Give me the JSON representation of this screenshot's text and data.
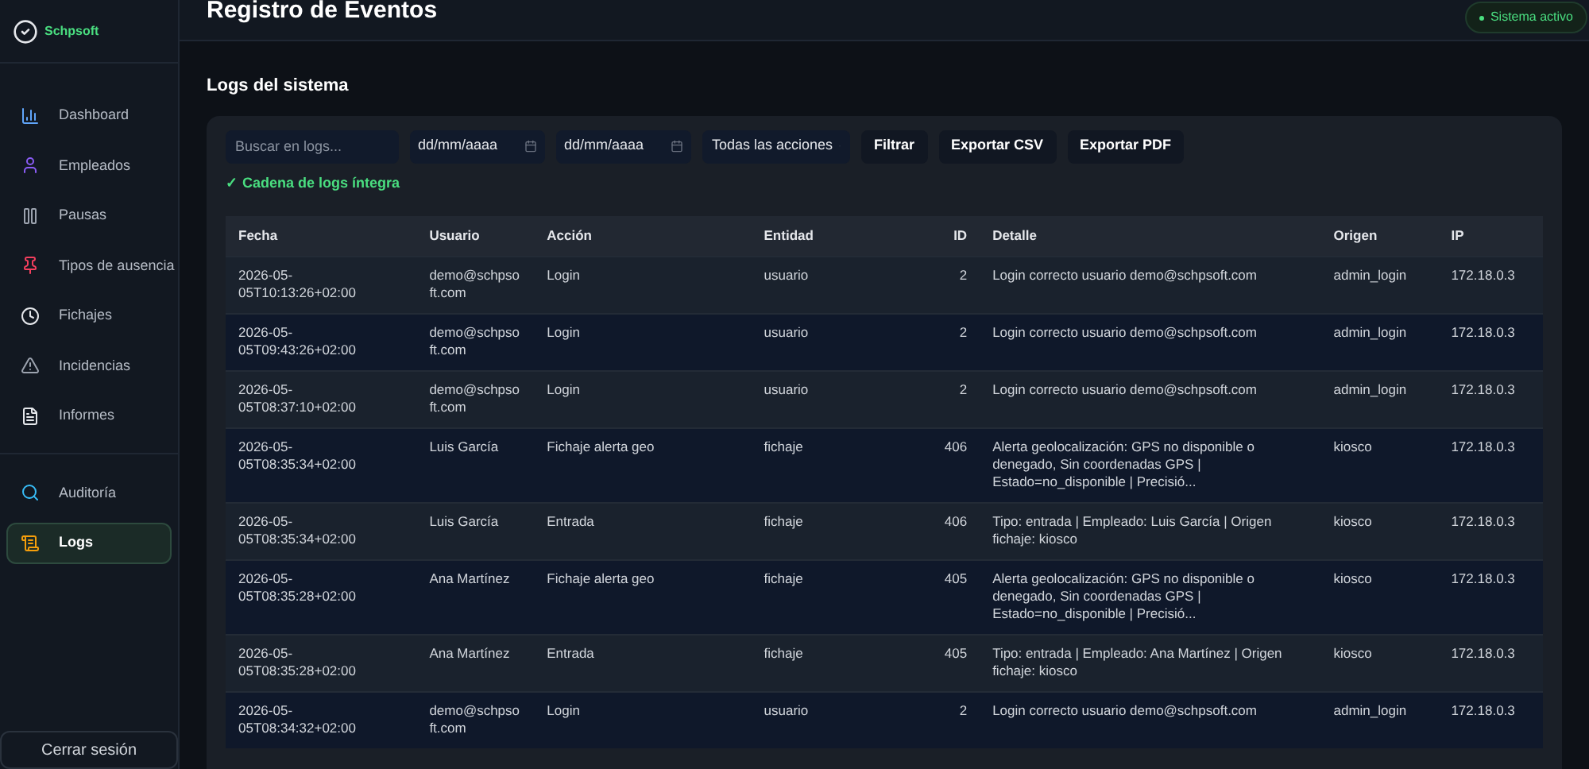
{
  "brand": {
    "name": "Schpsoft"
  },
  "sidebar": {
    "groups": [
      [
        {
          "label": "Dashboard",
          "selected": false
        },
        {
          "label": "Empleados",
          "selected": false
        },
        {
          "label": "Pausas",
          "selected": false
        },
        {
          "label": "Tipos de ausencia",
          "selected": false
        },
        {
          "label": "Fichajes",
          "selected": false
        },
        {
          "label": "Incidencias",
          "selected": false
        },
        {
          "label": "Informes",
          "selected": false
        }
      ],
      [
        {
          "label": "Auditoría",
          "selected": false
        },
        {
          "label": "Logs",
          "selected": true
        }
      ]
    ],
    "logout": "Cerrar sesión"
  },
  "header": {
    "title": "Registro de Eventos",
    "status": "Sistema activo"
  },
  "section_title": "Logs del sistema",
  "filters": {
    "search_placeholder": "Buscar en logs...",
    "date_from": "dd/mm/aaaa",
    "date_to": "dd/mm/aaaa",
    "action_select": "Todas las acciones",
    "buttons": [
      "Filtrar",
      "Exportar CSV",
      "Exportar PDF"
    ],
    "integrity": "✓ Cadena de logs íntegra",
    "integrity_ok": true
  },
  "table": {
    "columns": [
      "Fecha",
      "Usuario",
      "Acción",
      "Entidad",
      "ID",
      "Detalle",
      "Origen",
      "IP"
    ],
    "rows": [
      [
        "2026-05-05T10:13:26+02:00",
        "demo@schpsoft.com",
        "Login",
        "usuario",
        "2",
        "Login correcto usuario demo@schpsoft.com",
        "admin_login",
        "172.18.0.3"
      ],
      [
        "2026-05-05T09:43:26+02:00",
        "demo@schpsoft.com",
        "Login",
        "usuario",
        "2",
        "Login correcto usuario demo@schpsoft.com",
        "admin_login",
        "172.18.0.3"
      ],
      [
        "2026-05-05T08:37:10+02:00",
        "demo@schpsoft.com",
        "Login",
        "usuario",
        "2",
        "Login correcto usuario demo@schpsoft.com",
        "admin_login",
        "172.18.0.3"
      ],
      [
        "2026-05-05T08:35:34+02:00",
        "Luis García",
        "Fichaje alerta geo",
        "fichaje",
        "406",
        "Alerta geolocalización: GPS no disponible o denegado, Sin coordenadas GPS | Estado=no_disponible | Precisió...",
        "kiosco",
        "172.18.0.3"
      ],
      [
        "2026-05-05T08:35:34+02:00",
        "Luis García",
        "Entrada",
        "fichaje",
        "406",
        "Tipo: entrada | Empleado: Luis García | Origen fichaje: kiosco",
        "kiosco",
        "172.18.0.3"
      ],
      [
        "2026-05-05T08:35:28+02:00",
        "Ana Martínez",
        "Fichaje alerta geo",
        "fichaje",
        "405",
        "Alerta geolocalización: GPS no disponible o denegado, Sin coordenadas GPS | Estado=no_disponible | Precisió...",
        "kiosco",
        "172.18.0.3"
      ],
      [
        "2026-05-05T08:35:28+02:00",
        "Ana Martínez",
        "Entrada",
        "fichaje",
        "405",
        "Tipo: entrada | Empleado: Ana Martínez | Origen fichaje: kiosco",
        "kiosco",
        "172.18.0.3"
      ],
      [
        "2026-05-05T08:34:32+02:00",
        "demo@schpsoft.com",
        "Login",
        "usuario",
        "2",
        "Login correcto usuario demo@schpsoft.com",
        "admin_login",
        "172.18.0.3"
      ]
    ]
  }
}
